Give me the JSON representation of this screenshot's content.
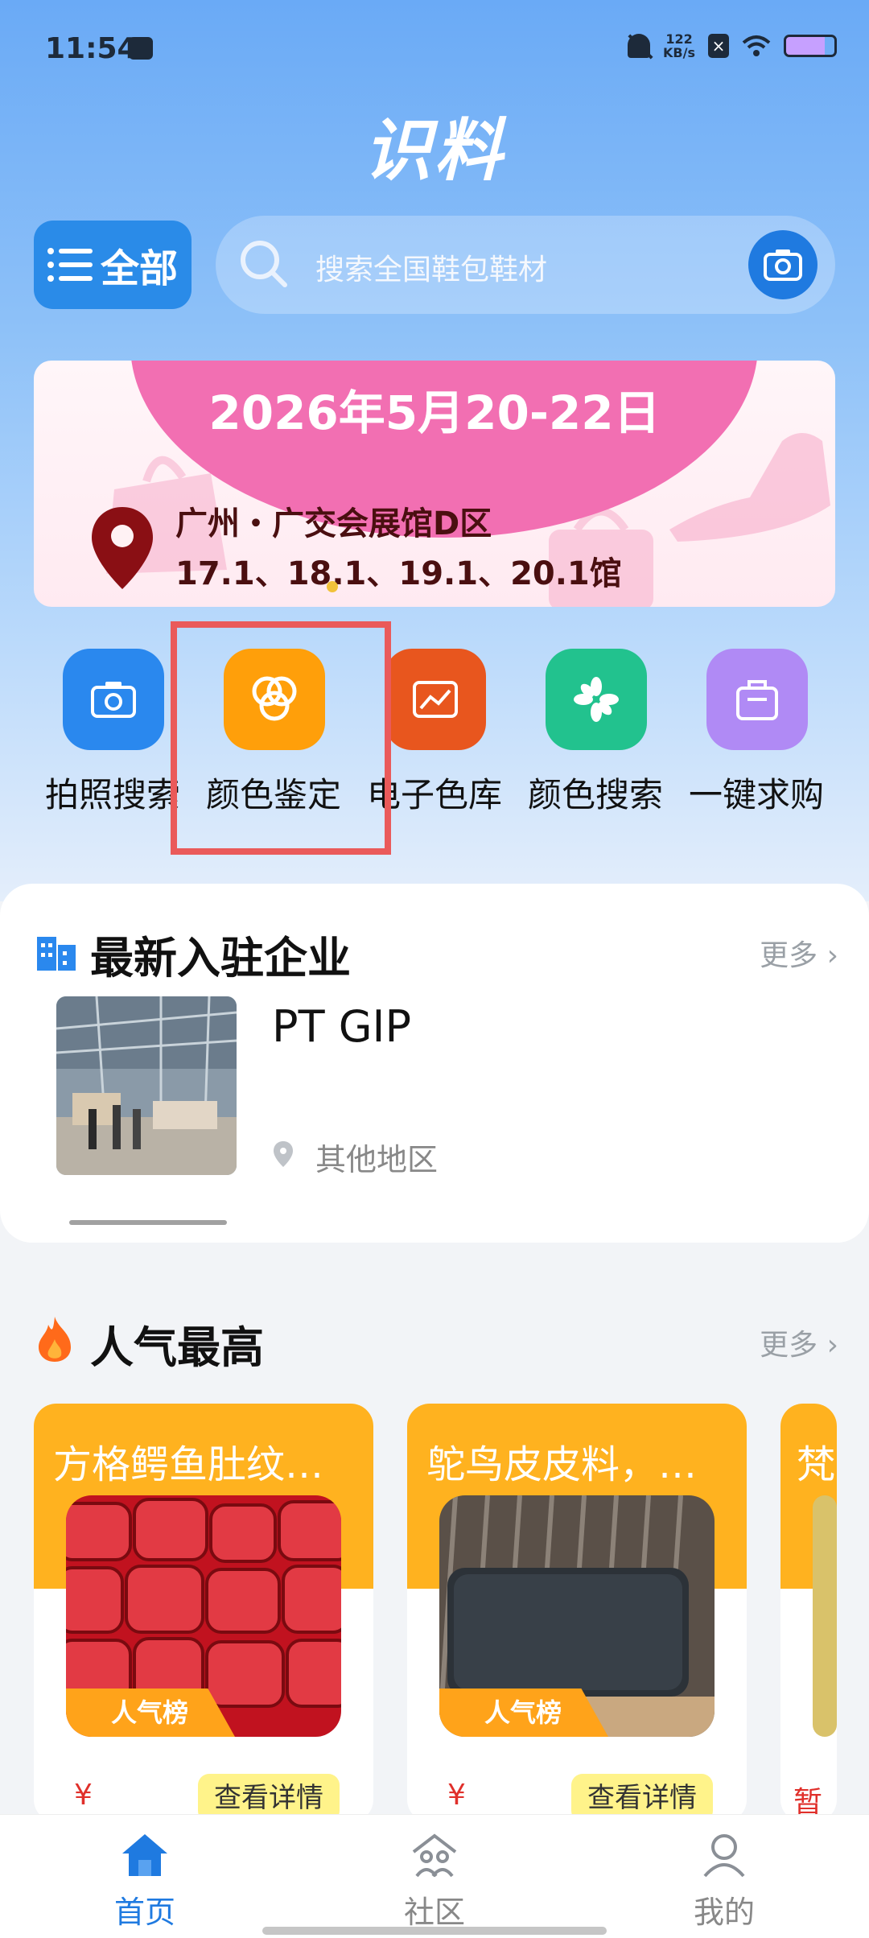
{
  "status_bar": {
    "time": "11:54",
    "speed_value": "122",
    "speed_unit": "KB/s",
    "x_badge": "×"
  },
  "app": {
    "title": "识料"
  },
  "category_button": {
    "label": "全部"
  },
  "search": {
    "placeholder": "搜索全国鞋包鞋材"
  },
  "banner": {
    "date": "2026年5月20-22日",
    "location": "广州・广交会展馆D区",
    "halls": "17.1、18.1、19.1、20.1馆",
    "accent_color": "#f26fb2"
  },
  "quick_actions": [
    {
      "label": "拍照搜索",
      "icon": "camera-icon",
      "color": "#2a88ee"
    },
    {
      "label": "颜色鉴定",
      "icon": "color-rings-icon",
      "color": "#ff9f0a"
    },
    {
      "label": "电子色库",
      "icon": "image-frame-icon",
      "color": "#e8561e"
    },
    {
      "label": "颜色搜索",
      "icon": "asterisk-icon",
      "color": "#22c28e"
    },
    {
      "label": "一键求购",
      "icon": "bag-icon",
      "color": "#b08af5"
    }
  ],
  "enterprise_section": {
    "title": "最新入驻企业",
    "more": "更多 ›",
    "items": [
      {
        "name": "PT GIP",
        "location": "其他地区"
      }
    ]
  },
  "popular_section": {
    "title": "人气最高",
    "more": "更多 ›",
    "products": [
      {
        "title": "方格鳄鱼肚纹…",
        "badge": "人气榜",
        "price": "¥",
        "detail": "查看详情"
      },
      {
        "title": "鸵鸟皮皮料，…",
        "badge": "人气榜",
        "price": "¥",
        "detail": "查看详情"
      },
      {
        "title": "梵",
        "badge": "",
        "price": "暂",
        "detail": ""
      }
    ]
  },
  "bottom_nav": [
    {
      "label": "首页",
      "icon": "home-icon",
      "active": true
    },
    {
      "label": "社区",
      "icon": "community-icon",
      "active": false
    },
    {
      "label": "我的",
      "icon": "profile-icon",
      "active": false
    }
  ],
  "colors": {
    "primary": "#1f7ae0",
    "highlight_border": "#ea5a5a",
    "badge_orange": "#ffa31a"
  }
}
